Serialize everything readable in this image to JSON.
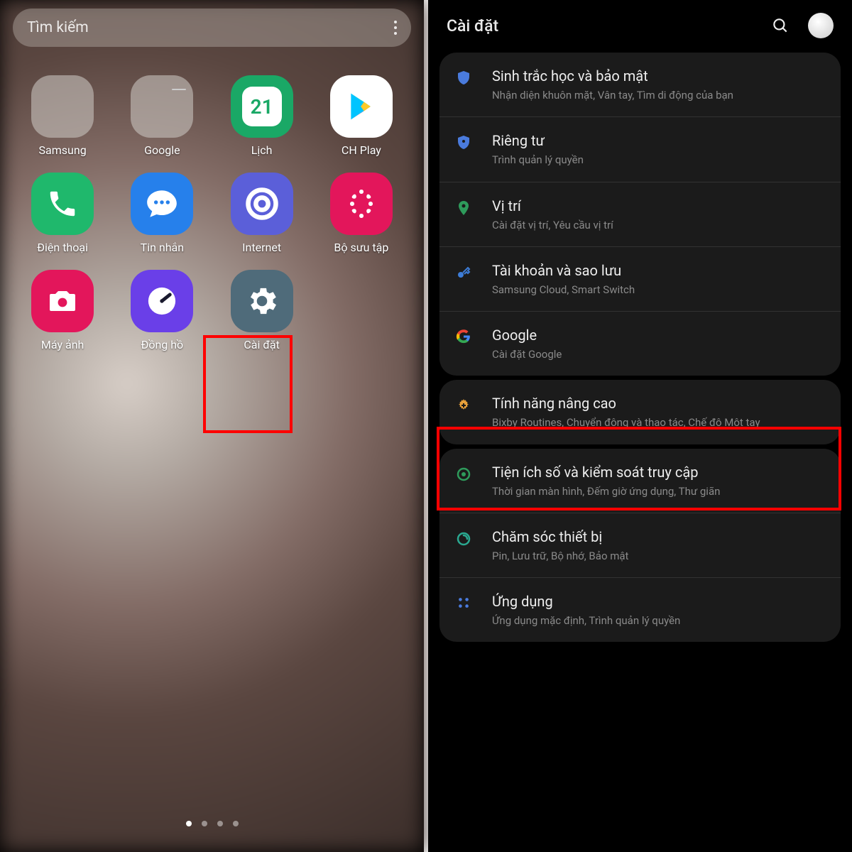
{
  "left": {
    "search_placeholder": "Tìm kiếm",
    "apps": [
      {
        "label": "Samsung"
      },
      {
        "label": "Google"
      },
      {
        "label": "Lịch",
        "calendar_day": "21"
      },
      {
        "label": "CH Play"
      },
      {
        "label": "Điện thoại"
      },
      {
        "label": "Tin nhắn"
      },
      {
        "label": "Internet"
      },
      {
        "label": "Bộ sưu tập"
      },
      {
        "label": "Máy ảnh"
      },
      {
        "label": "Đồng hồ"
      },
      {
        "label": "Cài đặt"
      }
    ]
  },
  "right": {
    "title": "Cài đặt",
    "groups": [
      {
        "items": [
          {
            "icon": "shield-blue",
            "title": "Sinh trắc học và bảo mật",
            "sub": "Nhận diện khuôn mặt, Vân tay, Tìm di động của bạn"
          },
          {
            "icon": "shield-badge",
            "title": "Riêng tư",
            "sub": "Trình quản lý quyền"
          },
          {
            "icon": "location",
            "title": "Vị trí",
            "sub": "Cài đặt vị trí, Yêu cầu vị trí"
          },
          {
            "icon": "key",
            "title": "Tài khoản và sao lưu",
            "sub": "Samsung Cloud, Smart Switch"
          },
          {
            "icon": "google",
            "title": "Google",
            "sub": "Cài đặt Google"
          }
        ]
      },
      {
        "items": [
          {
            "icon": "plus-gear",
            "title": "Tính năng nâng cao",
            "sub": "Bixby Routines, Chuyển động và thao tác, Chế độ Một tay"
          }
        ]
      },
      {
        "items": [
          {
            "icon": "wellbeing",
            "title": "Tiện ích số và kiểm soát truy cập",
            "sub": "Thời gian màn hình, Đếm giờ ứng dụng, Thư giãn"
          },
          {
            "icon": "device-care",
            "title": "Chăm sóc thiết bị",
            "sub": "Pin, Lưu trữ, Bộ nhớ, Bảo mật"
          },
          {
            "icon": "apps-grid",
            "title": "Ứng dụng",
            "sub": "Ứng dụng mặc định, Trình quản lý quyền"
          }
        ]
      }
    ]
  }
}
